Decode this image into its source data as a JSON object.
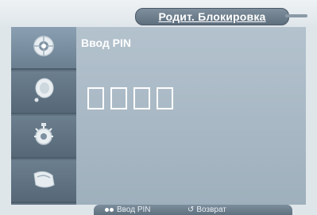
{
  "header": {
    "title": "Родит. Блокировка"
  },
  "sidebar": {
    "items": [
      {
        "icon": "picture-icon"
      },
      {
        "icon": "sound-icon"
      },
      {
        "icon": "channel-icon"
      },
      {
        "icon": "setup-icon"
      }
    ],
    "active_index": 0
  },
  "main": {
    "heading": "Ввод PIN",
    "pin_boxes": 4
  },
  "footer": {
    "enter_label": "Ввод PIN",
    "return_label": "Возврат"
  },
  "colors": {
    "accent": "#5f7282",
    "panel": "#a9b9c5",
    "text": "#ffffff"
  }
}
